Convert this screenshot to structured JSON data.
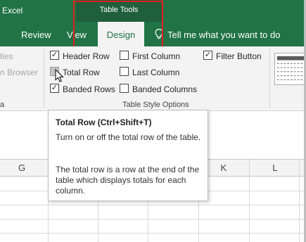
{
  "title_bar": {
    "app_name": "Excel",
    "context_group": "Table Tools"
  },
  "tabs": [
    {
      "label": "Review",
      "selected": false
    },
    {
      "label": "View",
      "selected": false
    },
    {
      "label": "Design",
      "selected": true
    }
  ],
  "tell_me": {
    "text": "Tell me what you want to do",
    "icon": "lightbulb-icon"
  },
  "ribbon": {
    "left_group_partial": {
      "item1": "ties",
      "item2": "n Browser",
      "group_label": "a"
    },
    "table_style_options": {
      "group_label": "Table Style Options",
      "options": [
        {
          "label": "Header Row",
          "checked": true
        },
        {
          "label": "Total Row",
          "checked": false,
          "hovered": true
        },
        {
          "label": "Banded Rows",
          "checked": true
        },
        {
          "label": "First Column",
          "checked": false
        },
        {
          "label": "Last Column",
          "checked": false
        },
        {
          "label": "Banded Columns",
          "checked": false
        },
        {
          "label": "Filter Button",
          "checked": true
        }
      ]
    }
  },
  "tooltip": {
    "title": "Total Row (Ctrl+Shift+T)",
    "paragraph1": "Turn on or off the total row of the table.",
    "paragraph2": "The total row is a row at the end of the table which displays totals for each column."
  },
  "sheet": {
    "visible_column_headers": [
      "G",
      "K",
      "L"
    ]
  },
  "colors": {
    "excel_green": "#217346",
    "context_tab_green": "#1f5f3c",
    "highlight_red": "#e02020",
    "ribbon_bg": "#f3f3f3"
  }
}
